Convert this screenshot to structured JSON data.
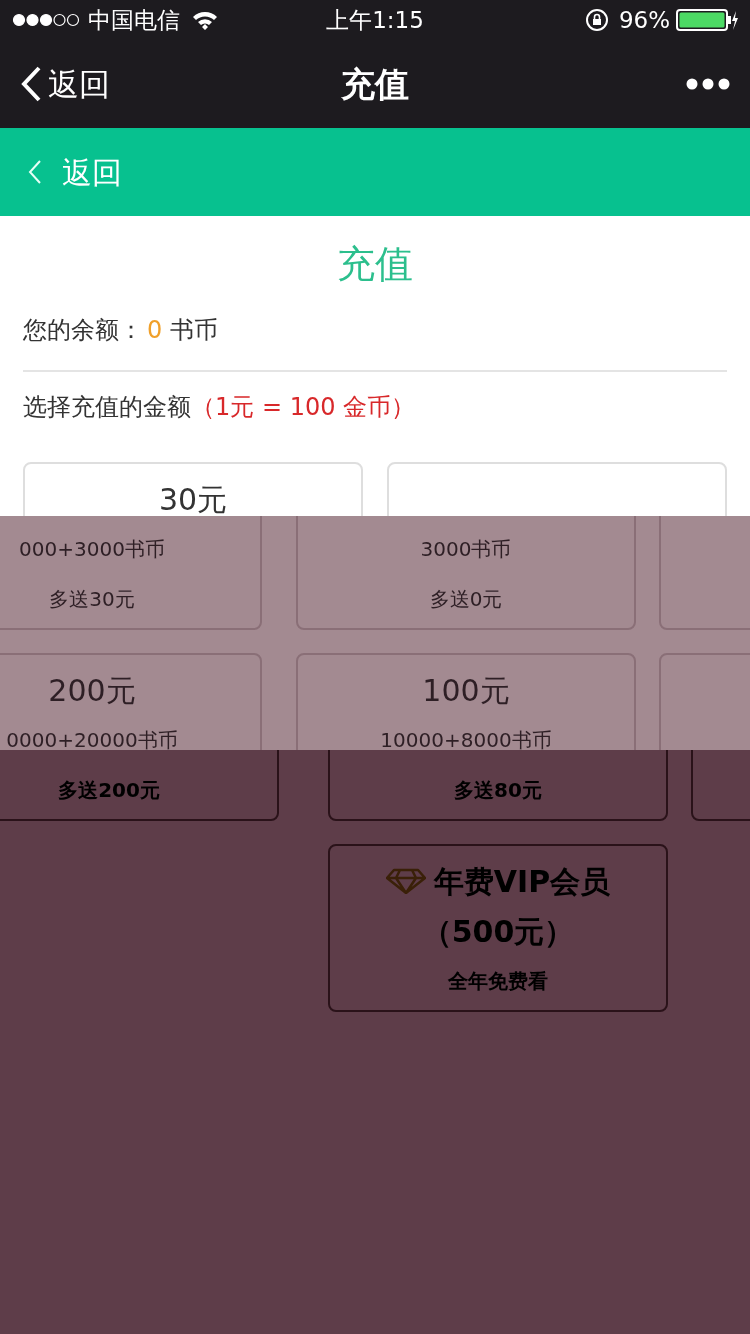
{
  "status_bar": {
    "carrier": "中国电信",
    "time": "上午1:15",
    "battery": "96%"
  },
  "nav_bar": {
    "back": "返回",
    "title": "充值"
  },
  "green_bar": {
    "back": "返回"
  },
  "page": {
    "title": "充值",
    "balance": {
      "label": "您的余额：",
      "amount": "0",
      "unit": "书币"
    },
    "prompt": {
      "text": "选择充值的金额",
      "rate": "（1元 = 100 金币）"
    }
  },
  "bands": [
    {
      "rows": [
        [
          {
            "kind": "card",
            "lines": [
              {
                "kind": "price",
                "text": "30元"
              }
            ]
          },
          {
            "kind": "card"
          }
        ]
      ]
    },
    {
      "rows": [
        [
          {
            "kind": "card",
            "lines": [
              {
                "kind": "coins",
                "text": "000+3000书币"
              },
              {
                "kind": "bonus",
                "text": "多送30元"
              }
            ]
          },
          {
            "kind": "card",
            "lines": [
              {
                "kind": "coins",
                "text": "3000书币"
              },
              {
                "kind": "bonus",
                "text": "多送0元"
              }
            ]
          },
          {
            "kind": "card"
          }
        ],
        [
          {
            "kind": "card",
            "lines": [
              {
                "kind": "price",
                "text": "200元"
              },
              {
                "kind": "coins",
                "text": "0000+20000书币"
              }
            ]
          },
          {
            "kind": "card",
            "lines": [
              {
                "kind": "price",
                "text": "100元"
              },
              {
                "kind": "coins",
                "text": "10000+8000书币"
              }
            ]
          },
          {
            "kind": "card"
          }
        ]
      ]
    },
    {
      "rows": [
        [
          {
            "kind": "none"
          },
          {
            "kind": "none"
          },
          {
            "kind": "none"
          }
        ],
        [
          {
            "kind": "card",
            "lines": [
              {
                "kind": "bonus",
                "text": "多送200元"
              }
            ]
          },
          {
            "kind": "card",
            "lines": [
              {
                "kind": "bonus",
                "text": "多送80元"
              }
            ]
          },
          {
            "kind": "card"
          }
        ],
        [
          {
            "kind": "none"
          },
          {
            "kind": "vip",
            "lines": [
              {
                "kind": "price",
                "text": "年费VIP会员"
              },
              {
                "kind": "coins",
                "text": "（500元）"
              },
              {
                "kind": "bonus",
                "text": "全年免费看"
              }
            ]
          },
          {
            "kind": "none"
          }
        ]
      ]
    }
  ]
}
